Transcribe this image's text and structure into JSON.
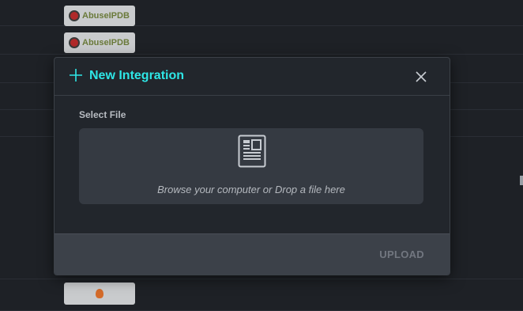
{
  "background": {
    "logo_text": "AbuseIPDB"
  },
  "modal": {
    "title": "New Integration",
    "select_file_label": "Select File",
    "dropzone_text": "Browse your computer or Drop a file here",
    "upload_label": "UPLOAD",
    "colors": {
      "accent": "#2ee6e6",
      "disabled_text": "#727780"
    },
    "icons": {
      "header": "plus-icon",
      "close": "close-icon",
      "dropzone": "document-icon"
    }
  }
}
